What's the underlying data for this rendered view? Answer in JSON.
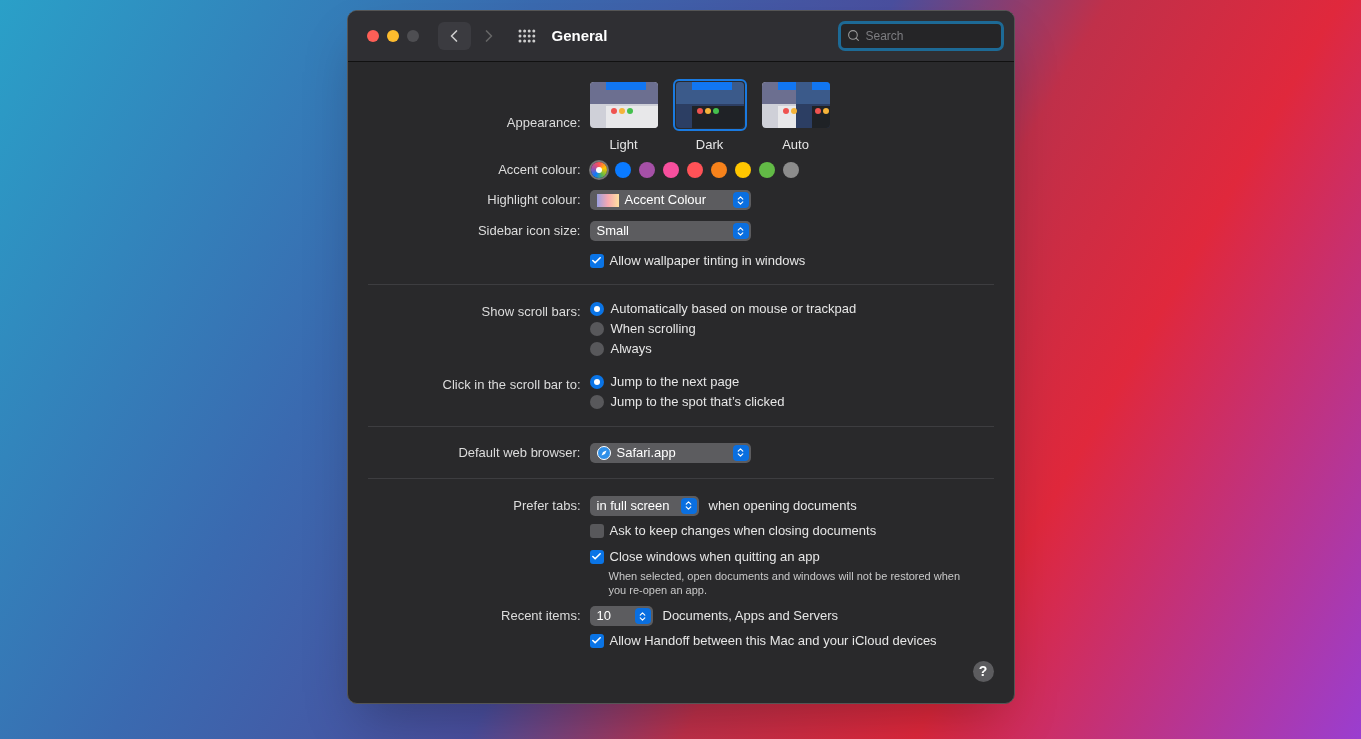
{
  "window": {
    "title": "General",
    "search": {
      "placeholder": "Search"
    }
  },
  "appearance": {
    "label": "Appearance:",
    "options": [
      {
        "label": "Light",
        "kind": "light",
        "selected": false
      },
      {
        "label": "Dark",
        "kind": "dark",
        "selected": true
      },
      {
        "label": "Auto",
        "kind": "auto",
        "selected": false
      }
    ]
  },
  "accent": {
    "label": "Accent colour:",
    "swatches": [
      {
        "kind": "multicolor",
        "selected": true
      },
      {
        "kind": "solid",
        "color": "#0a7aff",
        "selected": false
      },
      {
        "kind": "solid",
        "color": "#a550a7",
        "selected": false
      },
      {
        "kind": "solid",
        "color": "#f74f9e",
        "selected": false
      },
      {
        "kind": "solid",
        "color": "#ff5257",
        "selected": false
      },
      {
        "kind": "solid",
        "color": "#f7821b",
        "selected": false
      },
      {
        "kind": "solid",
        "color": "#ffc600",
        "selected": false
      },
      {
        "kind": "solid",
        "color": "#62ba46",
        "selected": false
      },
      {
        "kind": "solid",
        "color": "#8c8c8c",
        "selected": false
      }
    ]
  },
  "highlight": {
    "label": "Highlight colour:",
    "value": "Accent Colour"
  },
  "sidebar_icon_size": {
    "label": "Sidebar icon size:",
    "value": "Small"
  },
  "wallpaper_tinting": {
    "label": "Allow wallpaper tinting in windows",
    "checked": true
  },
  "scroll_bars": {
    "label": "Show scroll bars:",
    "options": [
      {
        "label": "Automatically based on mouse or trackpad",
        "selected": true
      },
      {
        "label": "When scrolling",
        "selected": false
      },
      {
        "label": "Always",
        "selected": false
      }
    ]
  },
  "click_scroll": {
    "label": "Click in the scroll bar to:",
    "options": [
      {
        "label": "Jump to the next page",
        "selected": true
      },
      {
        "label": "Jump to the spot that’s clicked",
        "selected": false
      }
    ]
  },
  "browser": {
    "label": "Default web browser:",
    "value": "Safari.app"
  },
  "prefer_tabs": {
    "label": "Prefer tabs:",
    "value": "in full screen",
    "suffix": "when opening documents"
  },
  "ask_keep": {
    "label": "Ask to keep changes when closing documents",
    "checked": false
  },
  "close_windows": {
    "label": "Close windows when quitting an app",
    "checked": true,
    "note": "When selected, open documents and windows will not be restored when you re-open an app."
  },
  "recent_items": {
    "label": "Recent items:",
    "value": "10",
    "suffix": "Documents, Apps and Servers"
  },
  "handoff": {
    "label": "Allow Handoff between this Mac and your iCloud devices",
    "checked": true
  },
  "help": {
    "label": "?"
  }
}
